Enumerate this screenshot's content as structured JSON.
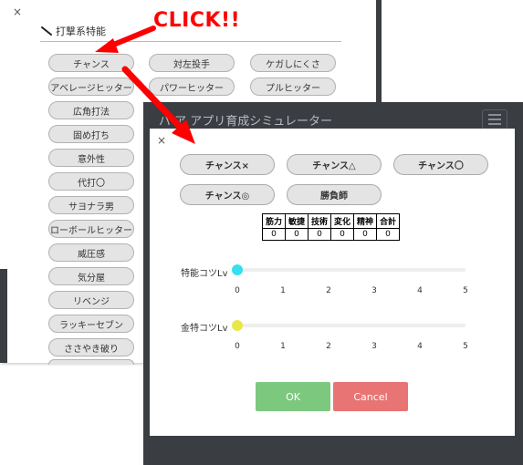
{
  "back_panel": {
    "close_label": "×",
    "section_title": "打撃系特能",
    "items": [
      "チャンス",
      "対左投手",
      "ケガしにくさ",
      "アベレージヒッター",
      "パワーヒッター",
      "プルヒッター",
      "広角打法",
      "固め打ち",
      "意外性",
      "代打〇",
      "サヨナラ男",
      "ローボールヒッター",
      "威圧感",
      "気分屋",
      "リベンジ",
      "ラッキーセブン",
      "ささやき破り"
    ]
  },
  "annotation": {
    "text": "CLICK!!",
    "color": "#ff0000"
  },
  "app": {
    "title": "パワプロアプリ育成シミュレーター",
    "title_visible": "パ ア アプリ育成シミュレーター"
  },
  "modal": {
    "close_label": "×",
    "options": [
      "チャンス×",
      "チャンス△",
      "チャンス〇",
      "チャンス◎",
      "勝負師"
    ],
    "stats": {
      "headers": [
        "筋力",
        "敏捷",
        "技術",
        "変化",
        "精神",
        "合計"
      ],
      "values": [
        "0",
        "0",
        "0",
        "0",
        "0",
        "0"
      ]
    },
    "sliders": [
      {
        "label": "特能コツLv",
        "value": 0,
        "ticks": [
          "0",
          "1",
          "2",
          "3",
          "4",
          "5"
        ],
        "knob_color": "#33e0f0"
      },
      {
        "label": "金特コツLv",
        "value": 0,
        "ticks": [
          "0",
          "1",
          "2",
          "3",
          "4",
          "5"
        ],
        "knob_color": "#e8e84a"
      }
    ],
    "ok_label": "OK",
    "cancel_label": "Cancel",
    "ok_color": "#7dc87f",
    "cancel_color": "#e87474"
  }
}
